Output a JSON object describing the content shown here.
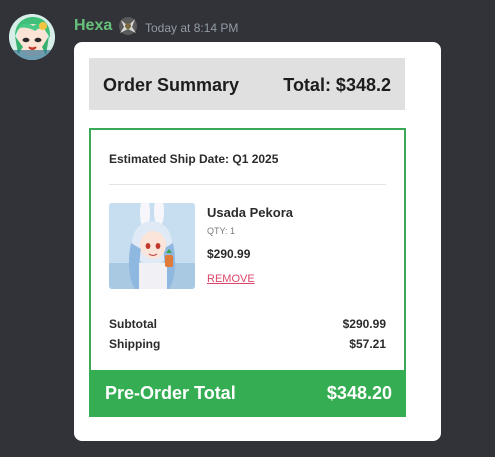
{
  "message": {
    "author": "Hexa",
    "timestamp": "Today at 8:14 PM",
    "author_color": "#66c27a"
  },
  "order": {
    "summary_title": "Order Summary",
    "summary_total": "Total: $348.2",
    "ship_date": "Estimated Ship Date: Q1 2025",
    "item": {
      "name": "Usada Pekora",
      "qty": "QTY: 1",
      "price": "$290.99",
      "remove_label": "REMOVE"
    },
    "subtotal_label": "Subtotal",
    "subtotal_value": "$290.99",
    "shipping_label": "Shipping",
    "shipping_value": "$57.21",
    "preorder_label": "Pre-Order Total",
    "preorder_value": "$348.20"
  },
  "colors": {
    "background": "#313338",
    "accent_green": "#35ad52",
    "remove_pink": "#d9466a",
    "summary_gray": "#e0e0e0"
  }
}
